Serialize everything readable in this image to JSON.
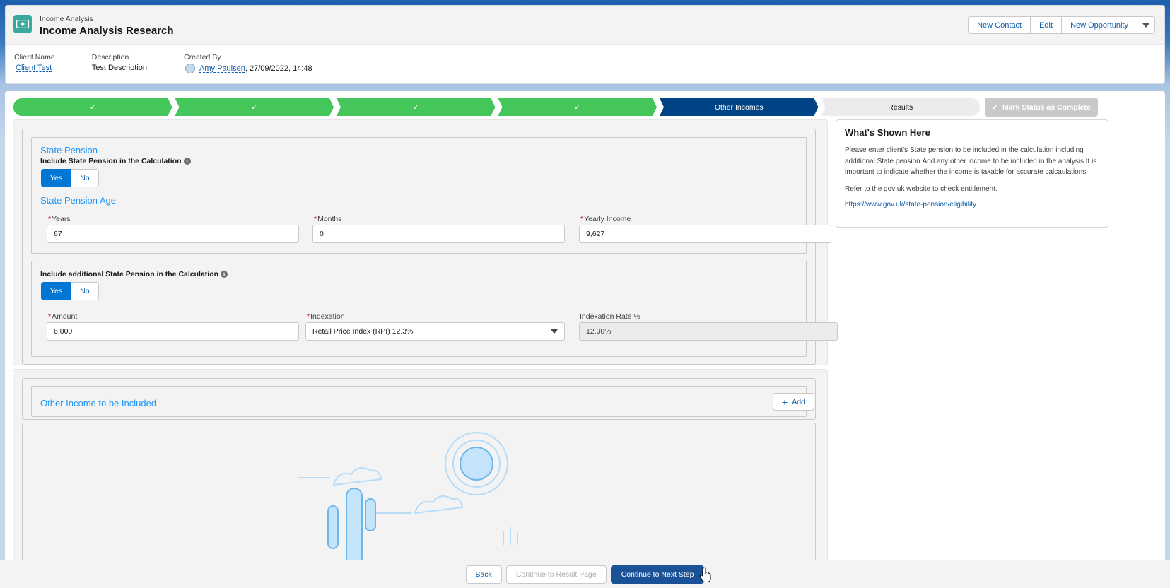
{
  "header": {
    "object_label": "Income Analysis",
    "title": "Income Analysis Research",
    "actions": [
      "New Contact",
      "Edit",
      "New Opportunity"
    ],
    "fields": {
      "client_name_label": "Client Name",
      "client_name_value": "Client Test",
      "description_label": "Description",
      "description_value": "Test Description",
      "created_by_label": "Created By",
      "created_by_user": "Amy Paulsen",
      "created_by_date": ", 27/09/2022, 14:48"
    }
  },
  "path": {
    "steps": [
      {
        "label": "✓",
        "status": "complete"
      },
      {
        "label": "✓",
        "status": "complete"
      },
      {
        "label": "✓",
        "status": "complete"
      },
      {
        "label": "✓",
        "status": "complete"
      },
      {
        "label": "Other Incomes",
        "status": "current"
      },
      {
        "label": "Results",
        "status": "incomplete"
      }
    ],
    "mark_complete_label": "Mark Status as Complete"
  },
  "state_pension": {
    "section_title": "State Pension",
    "include_label": "Include State Pension in the Calculation",
    "toggle_yes": "Yes",
    "toggle_no": "No",
    "include_selected": "Yes",
    "age_title": "State Pension Age",
    "years_label": "Years",
    "years_value": "67",
    "months_label": "Months",
    "months_value": "0",
    "yearly_income_label": "Yearly Income",
    "yearly_income_value": "9,627"
  },
  "additional_pension": {
    "include_label": "Include additional State Pension in the Calculation",
    "toggle_yes": "Yes",
    "toggle_no": "No",
    "include_selected": "Yes",
    "amount_label": "Amount",
    "amount_value": "6,000",
    "indexation_label": "Indexation",
    "indexation_value": "Retail Price Index (RPI) 12.3%",
    "rate_label": "Indexation Rate %",
    "rate_value": "12.30%"
  },
  "other_income": {
    "title": "Other Income to be Included",
    "add_label": "Add"
  },
  "info_panel": {
    "title": "What's Shown Here",
    "paragraph1": "Please enter client's State pension to be included in the calculation including additional State pension.Add any other income to be included in the analysis.It is important to indicate whether the income is taxable for accurate calcaulations",
    "paragraph2": "Refer to the gov uk website to check entitlement.",
    "link": "https://www.gov.uk/state-pension/eligibility"
  },
  "footer": {
    "back_label": "Back",
    "continue_result_label": "Continue to Result Page",
    "continue_next_label": "Continue to Next Step"
  },
  "colors": {
    "path_complete": "#45c65a",
    "path_current": "#014486",
    "brand_button": "#1b5297",
    "accent": "#0176d3"
  }
}
